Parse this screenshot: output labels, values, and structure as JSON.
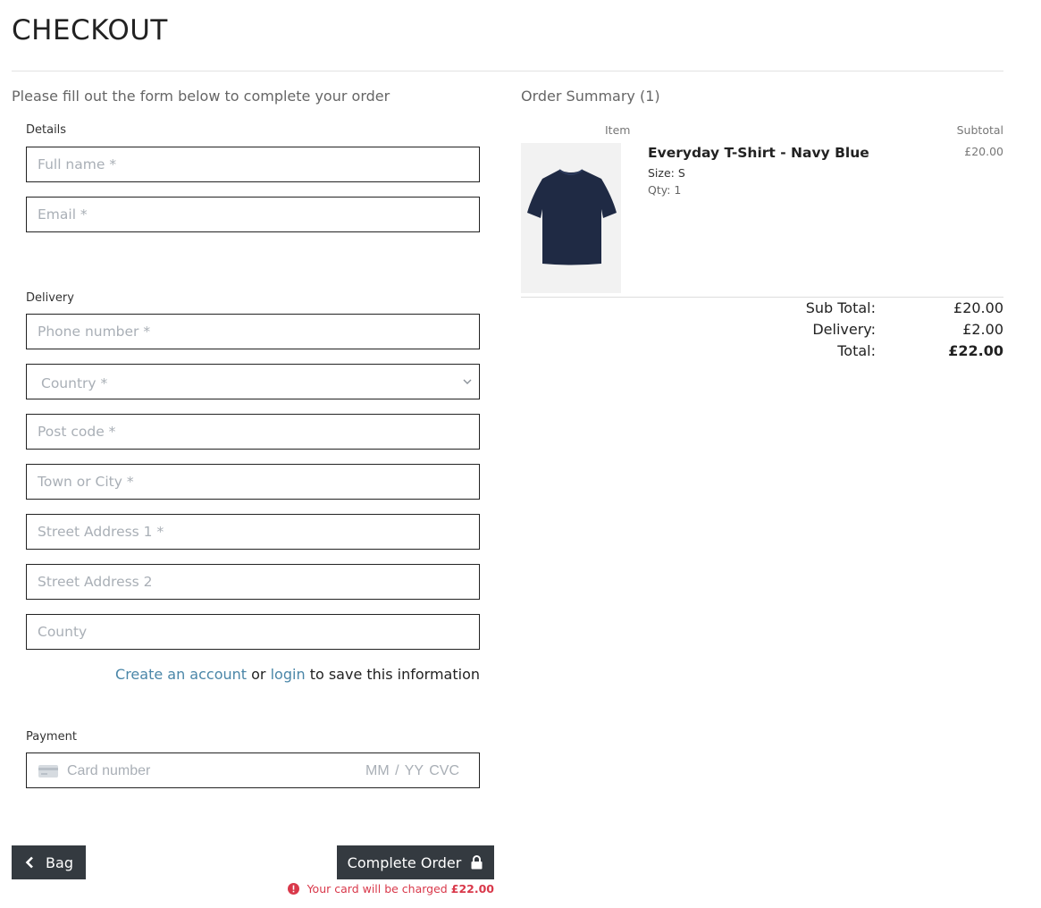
{
  "page": {
    "title": "CHECKOUT",
    "intro": "Please fill out the form below to complete your order"
  },
  "details": {
    "label": "Details",
    "full_name_placeholder": "Full name *",
    "email_placeholder": "Email *"
  },
  "delivery": {
    "label": "Delivery",
    "phone_placeholder": "Phone number *",
    "country_placeholder": "Country *",
    "postcode_placeholder": "Post code *",
    "town_placeholder": "Town or City *",
    "street1_placeholder": "Street Address 1 *",
    "street2_placeholder": "Street Address 2",
    "county_placeholder": "County"
  },
  "save_info": {
    "create_account": "Create an account",
    "or": "or",
    "login": "login",
    "suffix": "to save this information"
  },
  "payment": {
    "label": "Payment",
    "card_placeholder": "Card number",
    "expiry_cvc_placeholder": "MM / YY  CVC"
  },
  "buttons": {
    "bag": "Bag",
    "complete": "Complete Order"
  },
  "charge_note": {
    "text": "Your card will be charged",
    "amount": "£22.00"
  },
  "summary": {
    "title": "Order Summary (1)",
    "col_item": "Item",
    "col_subtotal": "Subtotal",
    "product": {
      "name": "Everyday T-Shirt - Navy Blue",
      "size": "Size: S",
      "qty": "Qty: 1",
      "price": "£20.00",
      "image_color": "#1f2a44"
    },
    "sub_total_label": "Sub Total:",
    "sub_total_value": "£20.00",
    "delivery_label": "Delivery:",
    "delivery_value": "£2.00",
    "total_label": "Total:",
    "total_value": "£22.00"
  },
  "colors": {
    "button_bg": "#343a40",
    "link": "#4a86a8",
    "alert": "#d9384a"
  }
}
